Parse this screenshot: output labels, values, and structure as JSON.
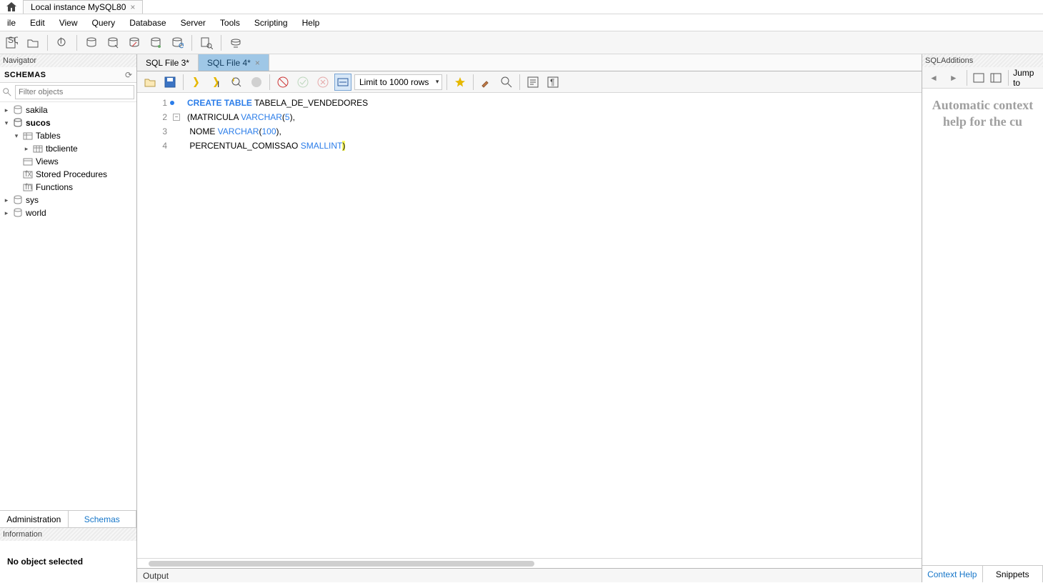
{
  "instance_tab_label": "Local instance MySQL80",
  "menu": [
    "ile",
    "Edit",
    "View",
    "Query",
    "Database",
    "Server",
    "Tools",
    "Scripting",
    "Help"
  ],
  "nav_panel_title": "Navigator",
  "schemas_label": "SCHEMAS",
  "filter_placeholder": "Filter objects",
  "schemas": {
    "items": [
      "sakila",
      "sucos",
      "sys",
      "world"
    ],
    "expanded": "sucos",
    "sucos_children": [
      "Tables",
      "Views",
      "Stored Procedures",
      "Functions"
    ],
    "tables_children": [
      "tbcliente"
    ]
  },
  "nav_tabs": {
    "admin": "Administration",
    "schemas": "Schemas"
  },
  "info_panel_title": "Information",
  "info_body": "No object selected",
  "sql_tabs": [
    "SQL File 3*",
    "SQL File 4*"
  ],
  "limit_text": "Limit to 1000 rows",
  "code_lines": {
    "l1": {
      "kw1": "CREATE",
      "kw2": "TABLE",
      "id": " TABELA_DE_VENDEDORES"
    },
    "l2": {
      "p1": "(MATRICULA ",
      "type": "VARCHAR",
      "p2": "(",
      "num": "5",
      "p3": "),"
    },
    "l3": {
      "p1": " NOME ",
      "type": "VARCHAR",
      "p2": "(",
      "num": "100",
      "p3": "),"
    },
    "l4": {
      "p1": " PERCENTUAL_COMISSAO ",
      "type": "SMALLINT",
      "p2": ")"
    }
  },
  "output_label": "Output",
  "right_title": "SQLAdditions",
  "right_jump": "Jump to",
  "right_body": "Automatic context help for the cu",
  "right_tabs": {
    "context": "Context Help",
    "snippets": "Snippets"
  }
}
